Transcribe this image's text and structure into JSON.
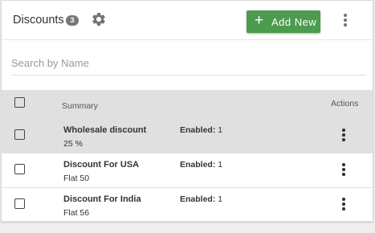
{
  "header": {
    "title": "Discounts",
    "count": "3",
    "settings_icon": "gear-icon",
    "add_button": {
      "icon": "plus-icon",
      "label": "Add New",
      "color": "#4d9b4e"
    },
    "more_icon": "more-vertical-icon"
  },
  "search": {
    "placeholder": "Search by Name",
    "value": ""
  },
  "table": {
    "columns": {
      "summary": "Summary",
      "actions": "Actions"
    },
    "rows": [
      {
        "name": "Wholesale discount",
        "value": "25 %",
        "status_label": "Enabled:",
        "status_value": "1",
        "selected": true
      },
      {
        "name": "Discount For USA",
        "value": "Flat 50",
        "status_label": "Enabled:",
        "status_value": "1",
        "selected": false
      },
      {
        "name": "Discount For India",
        "value": "Flat 56",
        "status_label": "Enabled:",
        "status_value": "1",
        "selected": false
      }
    ]
  }
}
